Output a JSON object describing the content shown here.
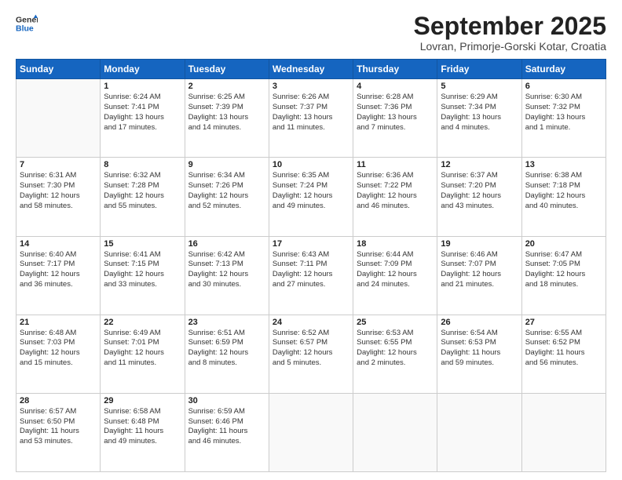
{
  "header": {
    "logo_line1": "General",
    "logo_line2": "Blue",
    "title": "September 2025",
    "subtitle": "Lovran, Primorje-Gorski Kotar, Croatia"
  },
  "calendar": {
    "days_of_week": [
      "Sunday",
      "Monday",
      "Tuesday",
      "Wednesday",
      "Thursday",
      "Friday",
      "Saturday"
    ],
    "rows": [
      [
        {
          "day": "",
          "text": ""
        },
        {
          "day": "1",
          "text": "Sunrise: 6:24 AM\nSunset: 7:41 PM\nDaylight: 13 hours\nand 17 minutes."
        },
        {
          "day": "2",
          "text": "Sunrise: 6:25 AM\nSunset: 7:39 PM\nDaylight: 13 hours\nand 14 minutes."
        },
        {
          "day": "3",
          "text": "Sunrise: 6:26 AM\nSunset: 7:37 PM\nDaylight: 13 hours\nand 11 minutes."
        },
        {
          "day": "4",
          "text": "Sunrise: 6:28 AM\nSunset: 7:36 PM\nDaylight: 13 hours\nand 7 minutes."
        },
        {
          "day": "5",
          "text": "Sunrise: 6:29 AM\nSunset: 7:34 PM\nDaylight: 13 hours\nand 4 minutes."
        },
        {
          "day": "6",
          "text": "Sunrise: 6:30 AM\nSunset: 7:32 PM\nDaylight: 13 hours\nand 1 minute."
        }
      ],
      [
        {
          "day": "7",
          "text": "Sunrise: 6:31 AM\nSunset: 7:30 PM\nDaylight: 12 hours\nand 58 minutes."
        },
        {
          "day": "8",
          "text": "Sunrise: 6:32 AM\nSunset: 7:28 PM\nDaylight: 12 hours\nand 55 minutes."
        },
        {
          "day": "9",
          "text": "Sunrise: 6:34 AM\nSunset: 7:26 PM\nDaylight: 12 hours\nand 52 minutes."
        },
        {
          "day": "10",
          "text": "Sunrise: 6:35 AM\nSunset: 7:24 PM\nDaylight: 12 hours\nand 49 minutes."
        },
        {
          "day": "11",
          "text": "Sunrise: 6:36 AM\nSunset: 7:22 PM\nDaylight: 12 hours\nand 46 minutes."
        },
        {
          "day": "12",
          "text": "Sunrise: 6:37 AM\nSunset: 7:20 PM\nDaylight: 12 hours\nand 43 minutes."
        },
        {
          "day": "13",
          "text": "Sunrise: 6:38 AM\nSunset: 7:18 PM\nDaylight: 12 hours\nand 40 minutes."
        }
      ],
      [
        {
          "day": "14",
          "text": "Sunrise: 6:40 AM\nSunset: 7:17 PM\nDaylight: 12 hours\nand 36 minutes."
        },
        {
          "day": "15",
          "text": "Sunrise: 6:41 AM\nSunset: 7:15 PM\nDaylight: 12 hours\nand 33 minutes."
        },
        {
          "day": "16",
          "text": "Sunrise: 6:42 AM\nSunset: 7:13 PM\nDaylight: 12 hours\nand 30 minutes."
        },
        {
          "day": "17",
          "text": "Sunrise: 6:43 AM\nSunset: 7:11 PM\nDaylight: 12 hours\nand 27 minutes."
        },
        {
          "day": "18",
          "text": "Sunrise: 6:44 AM\nSunset: 7:09 PM\nDaylight: 12 hours\nand 24 minutes."
        },
        {
          "day": "19",
          "text": "Sunrise: 6:46 AM\nSunset: 7:07 PM\nDaylight: 12 hours\nand 21 minutes."
        },
        {
          "day": "20",
          "text": "Sunrise: 6:47 AM\nSunset: 7:05 PM\nDaylight: 12 hours\nand 18 minutes."
        }
      ],
      [
        {
          "day": "21",
          "text": "Sunrise: 6:48 AM\nSunset: 7:03 PM\nDaylight: 12 hours\nand 15 minutes."
        },
        {
          "day": "22",
          "text": "Sunrise: 6:49 AM\nSunset: 7:01 PM\nDaylight: 12 hours\nand 11 minutes."
        },
        {
          "day": "23",
          "text": "Sunrise: 6:51 AM\nSunset: 6:59 PM\nDaylight: 12 hours\nand 8 minutes."
        },
        {
          "day": "24",
          "text": "Sunrise: 6:52 AM\nSunset: 6:57 PM\nDaylight: 12 hours\nand 5 minutes."
        },
        {
          "day": "25",
          "text": "Sunrise: 6:53 AM\nSunset: 6:55 PM\nDaylight: 12 hours\nand 2 minutes."
        },
        {
          "day": "26",
          "text": "Sunrise: 6:54 AM\nSunset: 6:53 PM\nDaylight: 11 hours\nand 59 minutes."
        },
        {
          "day": "27",
          "text": "Sunrise: 6:55 AM\nSunset: 6:52 PM\nDaylight: 11 hours\nand 56 minutes."
        }
      ],
      [
        {
          "day": "28",
          "text": "Sunrise: 6:57 AM\nSunset: 6:50 PM\nDaylight: 11 hours\nand 53 minutes."
        },
        {
          "day": "29",
          "text": "Sunrise: 6:58 AM\nSunset: 6:48 PM\nDaylight: 11 hours\nand 49 minutes."
        },
        {
          "day": "30",
          "text": "Sunrise: 6:59 AM\nSunset: 6:46 PM\nDaylight: 11 hours\nand 46 minutes."
        },
        {
          "day": "",
          "text": ""
        },
        {
          "day": "",
          "text": ""
        },
        {
          "day": "",
          "text": ""
        },
        {
          "day": "",
          "text": ""
        }
      ]
    ]
  }
}
